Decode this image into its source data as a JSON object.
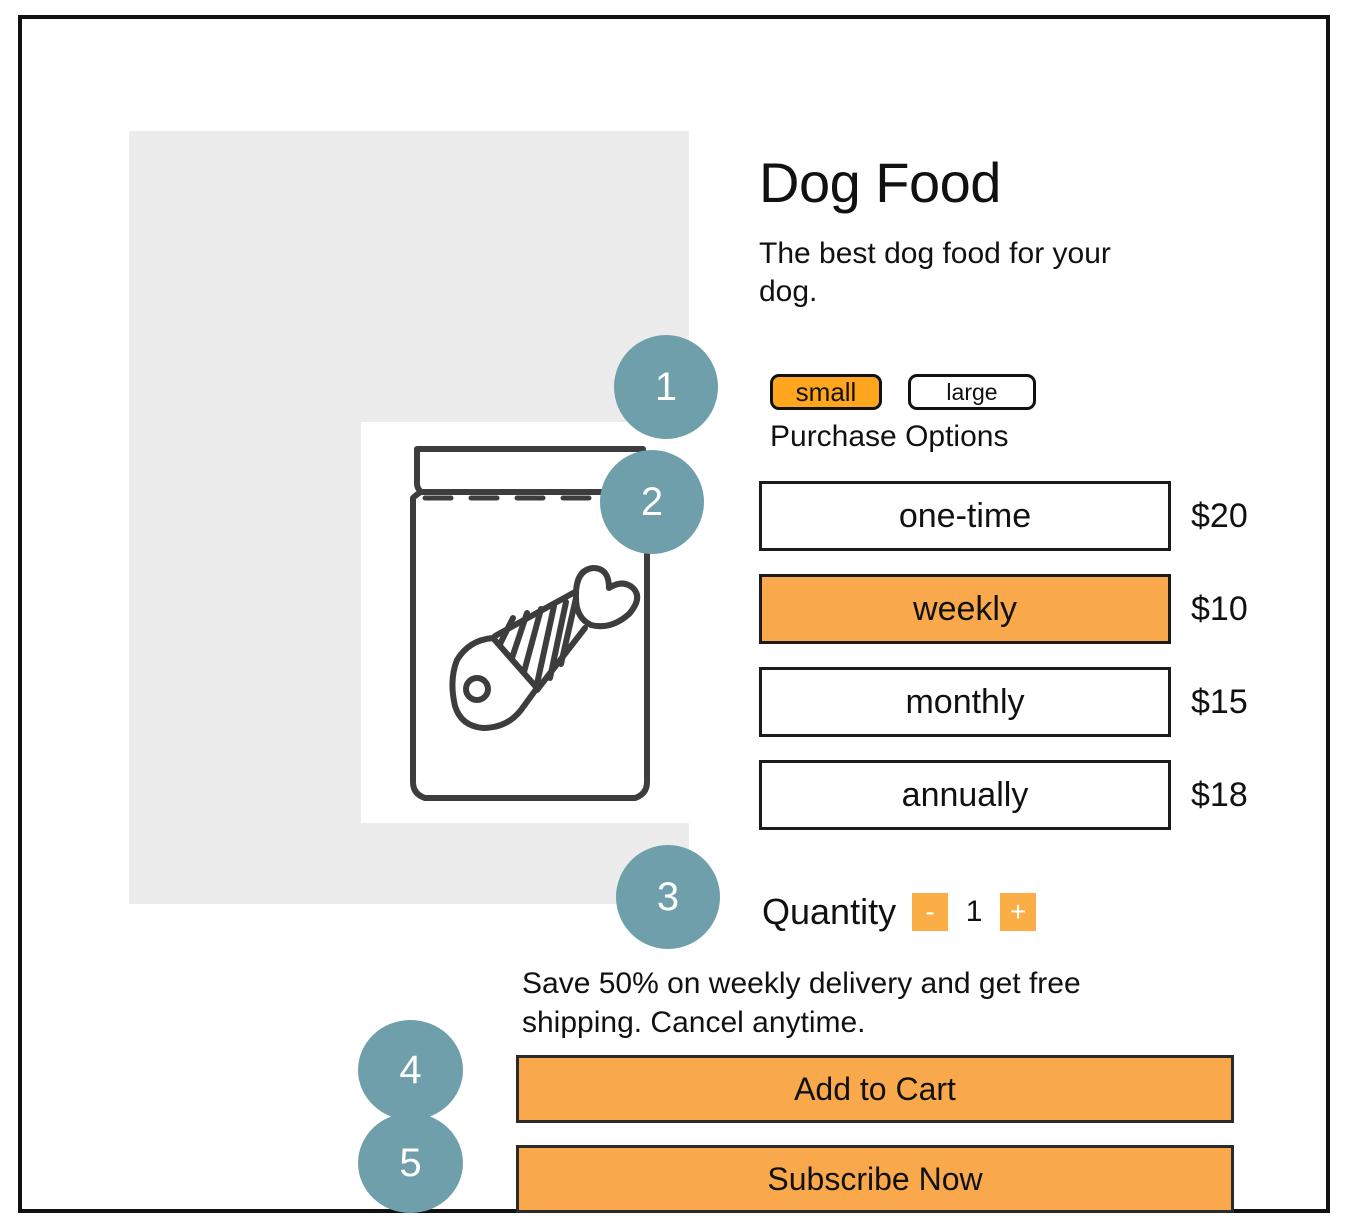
{
  "product": {
    "title": "Dog Food",
    "subtitle": "The best dog food for your dog.",
    "illustration_name": "jar-with-fish-bone-illustration"
  },
  "variants": {
    "options": [
      {
        "label": "small",
        "selected": true
      },
      {
        "label": "large",
        "selected": false
      }
    ]
  },
  "purchase": {
    "section_label": "Purchase Options",
    "options": [
      {
        "label": "one-time",
        "price": "$20",
        "selected": false
      },
      {
        "label": "weekly",
        "price": "$10",
        "selected": true
      },
      {
        "label": "monthly",
        "price": "$15",
        "selected": false
      },
      {
        "label": "annually",
        "price": "$18",
        "selected": false
      }
    ]
  },
  "quantity": {
    "label": "Quantity",
    "decrement_label": "-",
    "value": "1",
    "increment_label": "+"
  },
  "promo": {
    "text": "Save 50% on weekly delivery and get free shipping. Cancel anytime."
  },
  "actions": {
    "add_to_cart_label": "Add to Cart",
    "subscribe_label": "Subscribe Now"
  },
  "steps": [
    {
      "number": "1"
    },
    {
      "number": "2"
    },
    {
      "number": "3"
    },
    {
      "number": "4"
    },
    {
      "number": "5"
    }
  ],
  "colors": {
    "badge_teal": "#6E9FAB",
    "chip_orange": "#FFA51E",
    "row_orange": "#F9A94C",
    "qty_orange": "#FBAE46",
    "backdrop_gray": "#ECECEC",
    "border_black": "#111111"
  }
}
